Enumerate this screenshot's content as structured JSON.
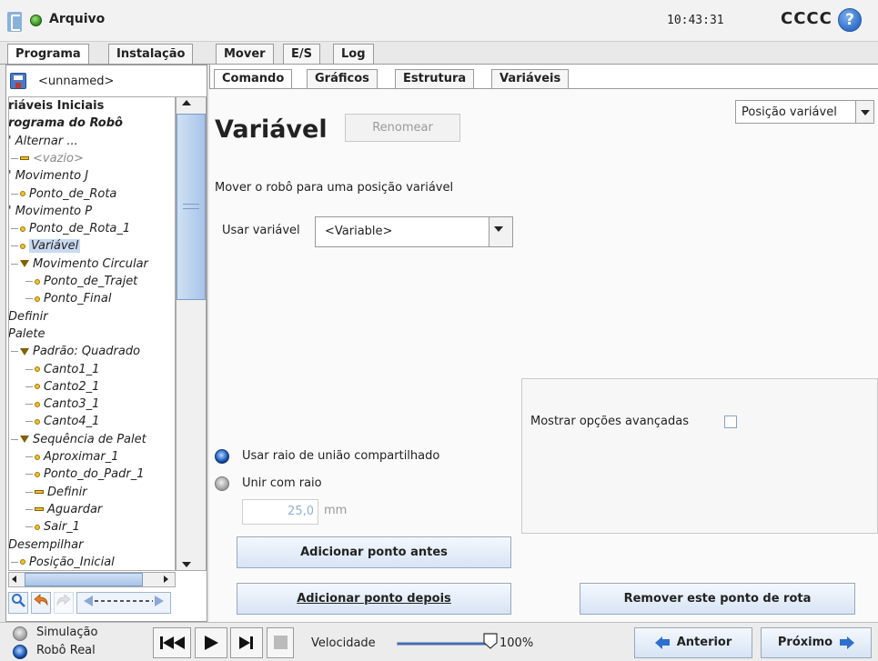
{
  "titlebar": {
    "file_label": "Arquivo",
    "clock": "10:43:31",
    "robot_name": "CCCC",
    "help_glyph": "?"
  },
  "main_tabs": [
    "Programa",
    "Instalação",
    "Mover",
    "E/S",
    "Log"
  ],
  "program": {
    "name": "<unnamed>",
    "tree": [
      {
        "text": "riáveis Iniciais",
        "indent": 0,
        "style": "bold",
        "icon": ""
      },
      {
        "text": "rograma do Robô",
        "indent": 0,
        "style": "bold-it",
        "icon": ""
      },
      {
        "text": "' Alternar ...",
        "indent": 0,
        "style": "it",
        "icon": ""
      },
      {
        "text": "<vazio>",
        "indent": 1,
        "style": "it-gray",
        "icon": "bar"
      },
      {
        "text": "' Movimento J",
        "indent": 0,
        "style": "it",
        "icon": ""
      },
      {
        "text": "Ponto_de_Rota",
        "indent": 1,
        "style": "it",
        "icon": "dot"
      },
      {
        "text": "' Movimento P",
        "indent": 0,
        "style": "it",
        "icon": ""
      },
      {
        "text": "Ponto_de_Rota_1",
        "indent": 1,
        "style": "it",
        "icon": "dot"
      },
      {
        "text": "Variável",
        "indent": 1,
        "style": "it",
        "icon": "dot",
        "selected": true
      },
      {
        "text": "Movimento Circular",
        "indent": 1,
        "style": "it",
        "icon": "tri"
      },
      {
        "text": "Ponto_de_Trajet",
        "indent": 2,
        "style": "it",
        "icon": "dot"
      },
      {
        "text": "Ponto_Final",
        "indent": 2,
        "style": "it",
        "icon": "dot"
      },
      {
        "text": "Definir",
        "indent": 0,
        "style": "it",
        "icon": ""
      },
      {
        "text": "Palete",
        "indent": 0,
        "style": "it",
        "icon": ""
      },
      {
        "text": "Padrão: Quadrado",
        "indent": 1,
        "style": "it",
        "icon": "tri"
      },
      {
        "text": "Canto1_1",
        "indent": 2,
        "style": "it",
        "icon": "dot"
      },
      {
        "text": "Canto2_1",
        "indent": 2,
        "style": "it",
        "icon": "dot"
      },
      {
        "text": "Canto3_1",
        "indent": 2,
        "style": "it",
        "icon": "dot"
      },
      {
        "text": "Canto4_1",
        "indent": 2,
        "style": "it",
        "icon": "dot"
      },
      {
        "text": "Sequência de Palet",
        "indent": 1,
        "style": "it",
        "icon": "tri"
      },
      {
        "text": "Aproximar_1",
        "indent": 2,
        "style": "it",
        "icon": "dot"
      },
      {
        "text": "Ponto_do_Padr_1",
        "indent": 2,
        "style": "it",
        "icon": "dot"
      },
      {
        "text": "Definir",
        "indent": 2,
        "style": "it",
        "icon": "bar"
      },
      {
        "text": "Aguardar",
        "indent": 2,
        "style": "it",
        "icon": "bar"
      },
      {
        "text": "Sair_1",
        "indent": 2,
        "style": "it",
        "icon": "dot"
      },
      {
        "text": "Desempilhar",
        "indent": 0,
        "style": "it",
        "icon": ""
      },
      {
        "text": "Posição_Inicial",
        "indent": 1,
        "style": "it",
        "icon": "dot"
      }
    ]
  },
  "sub_tabs": [
    "Comando",
    "Gráficos",
    "Estrutura",
    "Variáveis"
  ],
  "command": {
    "title": "Variável",
    "rename_label": "Renomear",
    "position_type": "Posição variável",
    "instruction": "Mover o robô para uma posição variável",
    "use_variable_label": "Usar variável",
    "variable_value": "<Variable>",
    "advanced_label": "Mostrar opções avançadas",
    "radio_shared_label": "Usar raio de união compartilhado",
    "radio_blend_label": "Unir com raio",
    "radius_value": "25,0",
    "radius_unit": "mm",
    "add_before_label": "Adicionar ponto antes",
    "add_after_label": "Adicionar ponto depois",
    "remove_label": "Remover este ponto de rota"
  },
  "bottombar": {
    "sim_label": "Simulação",
    "real_label": "Robô Real",
    "speed_label": "Velocidade",
    "speed_value": "100%",
    "speed_fraction": 1.0,
    "prev_label": "Anterior",
    "next_label": "Próximo"
  },
  "colors": {
    "accent_blue": "#2e6fcf",
    "status_green": "#2f8a18",
    "waypoint_yellow": "#f0c030"
  }
}
